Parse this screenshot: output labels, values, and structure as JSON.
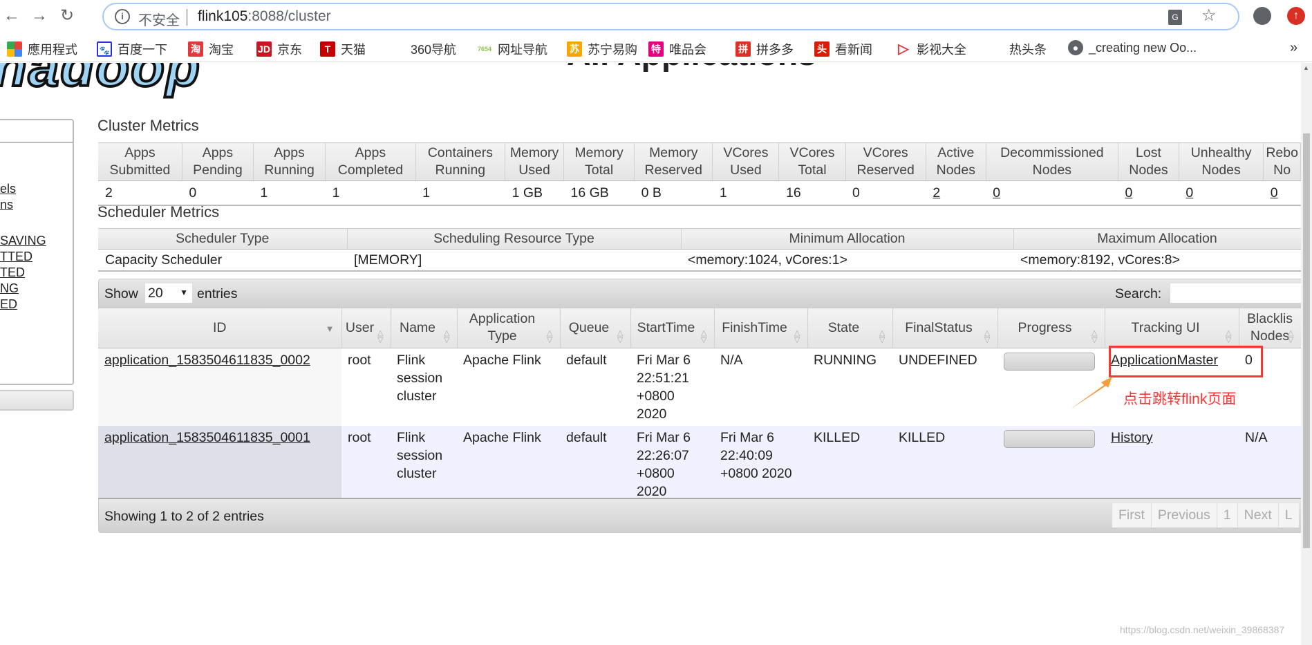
{
  "browser": {
    "url_host": "flink105",
    "url_rest": ":8088/cluster",
    "insecure_label": "不安全",
    "icons": [
      "back-icon",
      "forward-icon",
      "reload-icon",
      "info-icon",
      "translate-icon",
      "star-icon",
      "profile-icon",
      "update-icon"
    ],
    "bookmarks": [
      {
        "label": "應用程式",
        "icon": "apps-icon",
        "color": "#e8453c"
      },
      {
        "label": "百度一下",
        "icon": "baidu-paw-icon",
        "color": "#2932e1"
      },
      {
        "label": "淘宝",
        "icon": "taobao-icon",
        "color": "#e4393c",
        "glyph": "淘"
      },
      {
        "label": "京东",
        "icon": "jd-icon",
        "color": "#c91623",
        "glyph": "JD"
      },
      {
        "label": "天猫",
        "icon": "tmall-icon",
        "color": "#c40000",
        "glyph": "T"
      },
      {
        "label": "360导航",
        "icon": "",
        "color": ""
      },
      {
        "label": "网址导航",
        "icon": "7654-icon",
        "color": "#8bc34a",
        "glyph": "7654"
      },
      {
        "label": "苏宁易购",
        "icon": "suning-icon",
        "color": "#f7a700",
        "glyph": "苏"
      },
      {
        "label": "唯品会",
        "icon": "vip-icon",
        "color": "#e4007f",
        "glyph": "特"
      },
      {
        "label": "拼多多",
        "icon": "pinduoduo-icon",
        "color": "#e02e24",
        "glyph": "拼"
      },
      {
        "label": "看新闻",
        "icon": "toutiao-icon",
        "color": "#d81e06",
        "glyph": "头"
      },
      {
        "label": "影视大全",
        "icon": "video-play-icon",
        "color": "#d9363e",
        "glyph": "▷"
      },
      {
        "label": "热头条",
        "icon": "",
        "color": ""
      },
      {
        "label": "_creating new Oo...",
        "icon": "globe-icon",
        "color": "#5f6368",
        "glyph": "●"
      }
    ],
    "more": "»"
  },
  "header": {
    "logo": "hadoop",
    "title": "All Applications"
  },
  "sidebar": {
    "items": [
      "els",
      "ns",
      "SAVING",
      "TTED",
      "TED",
      "NG",
      "ED"
    ]
  },
  "cluster_metrics": {
    "title": "Cluster Metrics",
    "headers": [
      "Apps Submitted",
      "Apps Pending",
      "Apps Running",
      "Apps Completed",
      "Containers Running",
      "Memory Used",
      "Memory Total",
      "Memory Reserved",
      "VCores Used",
      "VCores Total",
      "VCores Reserved",
      "Active Nodes",
      "Decommissioned Nodes",
      "Lost Nodes",
      "Unhealthy Nodes",
      "Rebo No"
    ],
    "values": [
      "2",
      "0",
      "1",
      "1",
      "1",
      "1 GB",
      "16 GB",
      "0 B",
      "1",
      "16",
      "0",
      "2",
      "0",
      "0",
      "0",
      "0"
    ],
    "links": [
      11,
      12,
      13,
      14,
      15
    ]
  },
  "scheduler_metrics": {
    "title": "Scheduler Metrics",
    "headers": [
      "Scheduler Type",
      "Scheduling Resource Type",
      "Minimum Allocation",
      "Maximum Allocation"
    ],
    "values": [
      "Capacity Scheduler",
      "[MEMORY]",
      "<memory:1024, vCores:1>",
      "<memory:8192, vCores:8>"
    ]
  },
  "apps": {
    "show_label": "Show",
    "entries_label": "entries",
    "page_size": "20",
    "search_label": "Search:",
    "search_value": "",
    "headers": [
      "ID",
      "User",
      "Name",
      "Application Type",
      "Queue",
      "StartTime",
      "FinishTime",
      "State",
      "FinalStatus",
      "Progress",
      "Tracking UI",
      "Blacklis Nodes"
    ],
    "rows": [
      {
        "id": "application_1583504611835_0002",
        "user": "root",
        "name": "Flink session cluster",
        "type": "Apache Flink",
        "queue": "default",
        "start": "Fri Mar 6 22:51:21 +0800 2020",
        "finish": "N/A",
        "state": "RUNNING",
        "final": "UNDEFINED",
        "progress": 0,
        "tracking": "ApplicationMaster",
        "blacklisted": "0"
      },
      {
        "id": "application_1583504611835_0001",
        "user": "root",
        "name": "Flink session cluster",
        "type": "Apache Flink",
        "queue": "default",
        "start": "Fri Mar 6 22:26:07 +0800 2020",
        "finish": "Fri Mar 6 22:40:09 +0800 2020",
        "state": "KILLED",
        "final": "KILLED",
        "progress": 0,
        "tracking": "History",
        "blacklisted": "N/A"
      }
    ],
    "info": "Showing 1 to 2 of 2 entries",
    "pager": [
      "First",
      "Previous",
      "1",
      "Next",
      "L"
    ]
  },
  "annotation": {
    "text": "点击跳转flink页面",
    "color": "#ff3333",
    "arrow_color": "#f39c3c"
  },
  "watermark": "https://blog.csdn.net/weixin_39868387"
}
